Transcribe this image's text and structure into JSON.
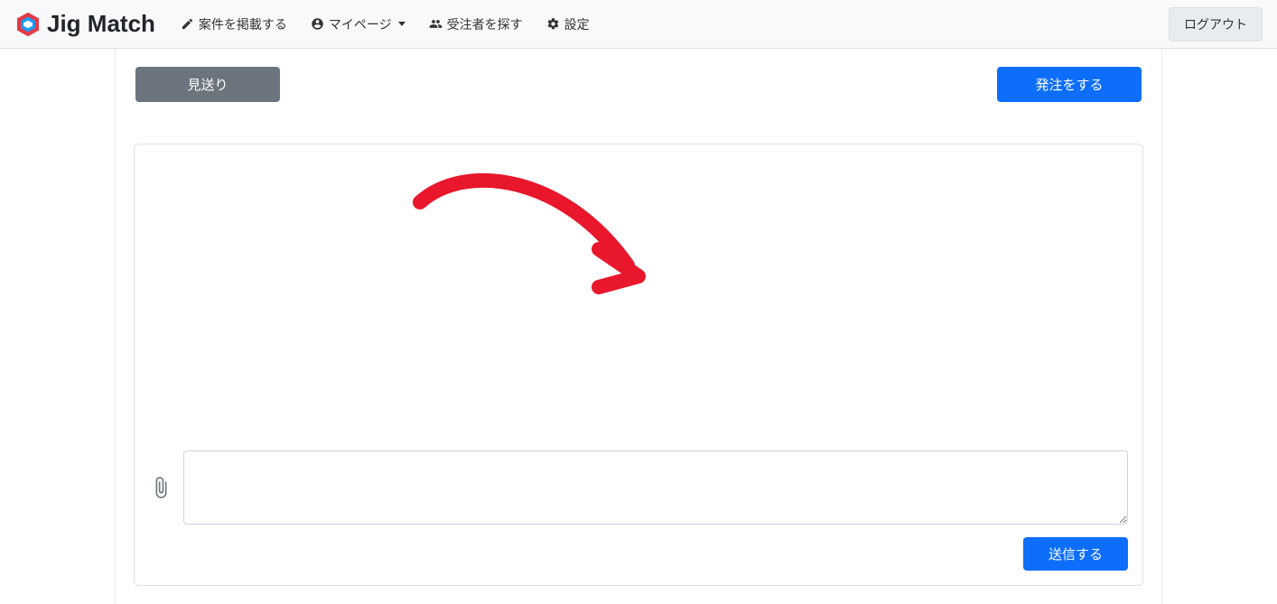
{
  "header": {
    "brand": "Jig Match",
    "nav": {
      "post_job": "案件を掲載する",
      "mypage": "マイページ",
      "find_contractor": "受注者を探す",
      "settings": "設定"
    },
    "logout": "ログアウト"
  },
  "actions": {
    "decline": "見送り",
    "order": "発注をする"
  },
  "chat": {
    "message_placeholder": "",
    "send": "送信する"
  }
}
